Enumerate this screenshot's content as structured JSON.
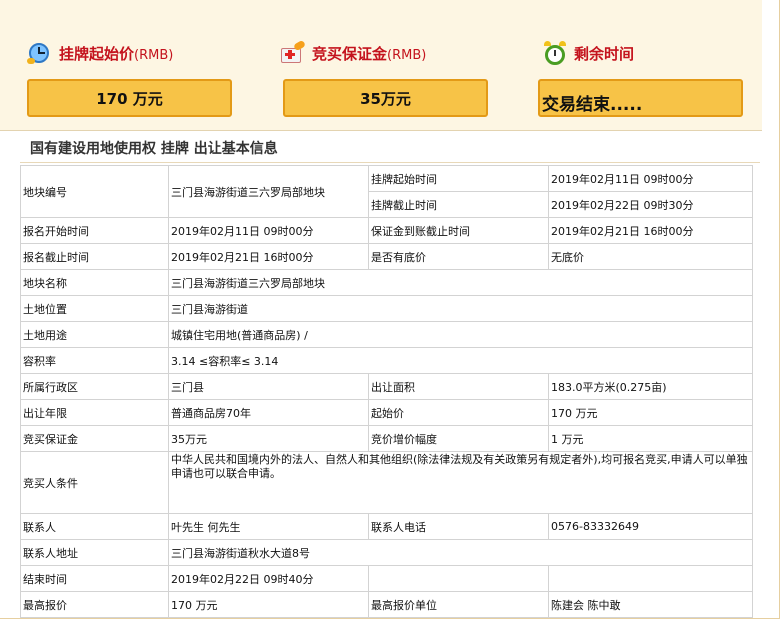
{
  "summary": {
    "start_price_label": "挂牌起始价",
    "start_price_unit_label": "(RMB)",
    "start_price_value": "170 万元",
    "deposit_label": "竞买保证金",
    "deposit_unit_label": "(RMB)",
    "deposit_value": "35万元",
    "remaining_label": "剩余时间",
    "remaining_value": "交易结束....."
  },
  "section_title": "国有建设用地使用权 挂牌 出让基本信息",
  "table": {
    "r1": {
      "k1": "地块编号",
      "v1": "三门县海游街道三六罗局部地块",
      "k2": "挂牌起始时间",
      "v2": "2019年02月11日 09时00分"
    },
    "r1b": {
      "k2": "挂牌截止时间",
      "v2": "2019年02月22日 09时30分"
    },
    "r2": {
      "k1": "报名开始时间",
      "v1": "2019年02月11日 09时00分",
      "k2": "保证金到账截止时间",
      "v2": "2019年02月21日 16时00分"
    },
    "r3": {
      "k1": "报名截止时间",
      "v1": "2019年02月21日 16时00分",
      "k2": "是否有底价",
      "v2": "无底价"
    },
    "r4": {
      "k1": "地块名称",
      "v1": "三门县海游街道三六罗局部地块"
    },
    "r5": {
      "k1": "土地位置",
      "v1": "三门县海游街道"
    },
    "r6": {
      "k1": "土地用途",
      "v1": "城镇住宅用地(普通商品房) /"
    },
    "r7": {
      "k1": "容积率",
      "v1": "3.14 ≤容积率≤ 3.14"
    },
    "r8": {
      "k1": "所属行政区",
      "v1": "三门县",
      "k2": "出让面积",
      "v2": "183.0平方米(0.275亩)"
    },
    "r9": {
      "k1": "出让年限",
      "v1": "普通商品房70年",
      "k2": "起始价",
      "v2": "170 万元"
    },
    "r10": {
      "k1": "竞买保证金",
      "v1": "35万元",
      "k2": "竞价增价幅度",
      "v2": "1 万元"
    },
    "r11": {
      "k1": "竞买人条件",
      "v1": "中华人民共和国境内外的法人、自然人和其他组织(除法律法规及有关政策另有规定者外),均可报名竞买,申请人可以单独申请也可以联合申请。"
    },
    "r12": {
      "k1": "联系人",
      "v1": "叶先生 何先生",
      "k2": "联系人电话",
      "v2": "0576-83332649"
    },
    "r13": {
      "k1": "联系人地址",
      "v1": "三门县海游街道秋水大道8号"
    },
    "r14": {
      "k1": "结束时间",
      "v1": "2019年02月22日 09时40分"
    },
    "r15": {
      "k1": "最高报价",
      "v1": "170 万元",
      "k2": "最高报价单位",
      "v2": "陈建会 陈中敢"
    }
  }
}
